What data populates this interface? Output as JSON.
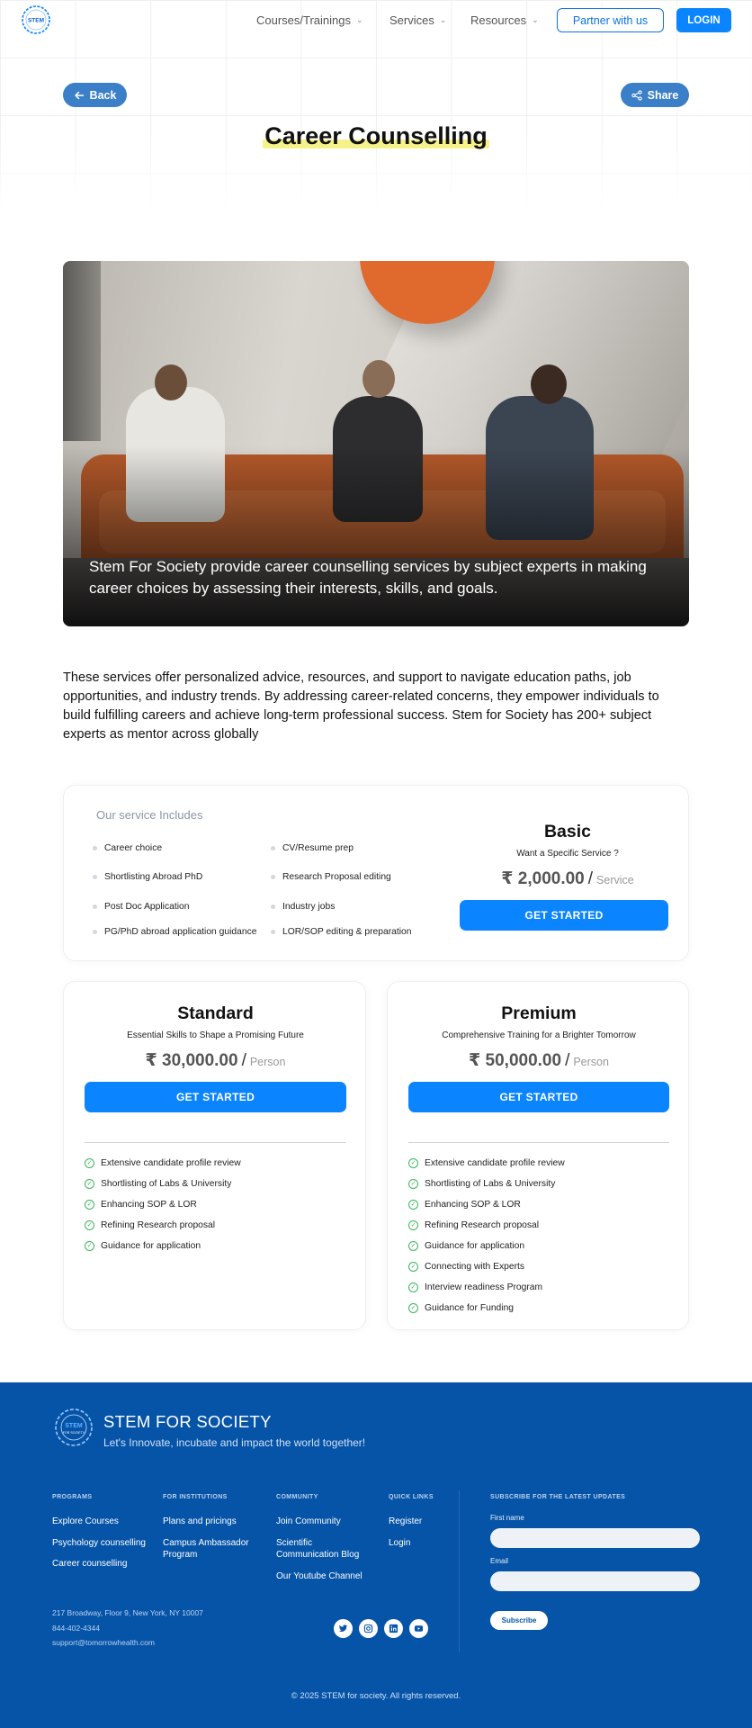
{
  "nav": {
    "logo_text": "STEM",
    "items": [
      {
        "label": "Courses/Trainings"
      },
      {
        "label": "Services"
      },
      {
        "label": "Resources"
      }
    ],
    "partner_label": "Partner with us",
    "login_label": "LOGIN"
  },
  "hero": {
    "back_label": "Back",
    "share_label": "Share",
    "title": "Career Counselling"
  },
  "hero_image": {
    "caption": "Stem For Society provide career counselling services by subject experts in making career choices by assessing their interests, skills, and goals."
  },
  "intro": "These services offer personalized advice, resources, and support to navigate education paths, job opportunities, and industry trends. By addressing career-related concerns, they empower individuals to build fulfilling careers and achieve long-term professional success. Stem for Society has 200+ subject experts as mentor across globally",
  "basic": {
    "includes_title": "Our service Includes",
    "items": [
      "Career choice",
      "CV/Resume prep",
      "Shortlisting Abroad PhD",
      "Research Proposal editing",
      "Post Doc Application",
      "Industry jobs",
      "PG/PhD abroad application guidance",
      "LOR/SOP editing & preparation"
    ],
    "name": "Basic",
    "subtitle": "Want a Specific Service ?",
    "price": "₹ 2,000.00",
    "separator": "/",
    "unit": "Service",
    "cta": "GET STARTED"
  },
  "standard": {
    "name": "Standard",
    "subtitle": "Essential Skills to Shape a Promising Future",
    "price": "₹ 30,000.00",
    "separator": "/",
    "unit": "Person",
    "cta": "GET STARTED",
    "features": [
      "Extensive candidate profile review",
      "Shortlisting of Labs & University",
      "Enhancing SOP & LOR",
      "Refining Research proposal",
      "Guidance for application"
    ]
  },
  "premium": {
    "name": "Premium",
    "subtitle": "Comprehensive Training for a Brighter Tomorrow",
    "price": "₹ 50,000.00",
    "separator": "/",
    "unit": "Person",
    "cta": "GET STARTED",
    "features": [
      "Extensive candidate profile review",
      "Shortlisting of Labs & University",
      "Enhancing SOP & LOR",
      "Refining Research proposal",
      "Guidance for application",
      "Connecting with Experts",
      "Interview readiness Program",
      "Guidance for Funding"
    ]
  },
  "footer": {
    "logo_text": "STEM",
    "logo_sub": "FOR SOCIETY",
    "brand": "STEM FOR SOCIETY",
    "tagline": "Let's Innovate, incubate and impact the world together!",
    "programs": {
      "heading": "PROGRAMS",
      "links": [
        "Explore Courses",
        "Psychology counselling",
        "Career counselling"
      ]
    },
    "institutions": {
      "heading": "FOR INSTITUTIONS",
      "links": [
        "Plans and pricings",
        "Campus Ambassador Program"
      ]
    },
    "community": {
      "heading": "COMMUNITY",
      "links": [
        "Join Community",
        "Scientific Communication Blog",
        "Our Youtube Channel"
      ]
    },
    "quick_links": {
      "heading": "QUICK LINKS",
      "links": [
        "Register",
        "Login"
      ]
    },
    "subscribe": {
      "heading": "SUBSCRIBE FOR THE LATEST UPDATES",
      "first_name_label": "First name",
      "email_label": "Email",
      "button": "Subscribe"
    },
    "address": "217 Broadway, Floor 9, New York, NY 10007",
    "phone": "844-402-4344",
    "email": "support@tomorrowhealth.com",
    "social_icons": [
      "twitter-icon",
      "instagram-icon",
      "linkedin-icon",
      "youtube-icon"
    ],
    "copyright": "© 2025 STEM for society. All rights reserved."
  },
  "colors": {
    "primary": "#0a84ff",
    "pill": "#3a7fc8",
    "footer_bg": "#0654a8",
    "highlight": "#f6f28a",
    "check": "#3cb55b"
  }
}
